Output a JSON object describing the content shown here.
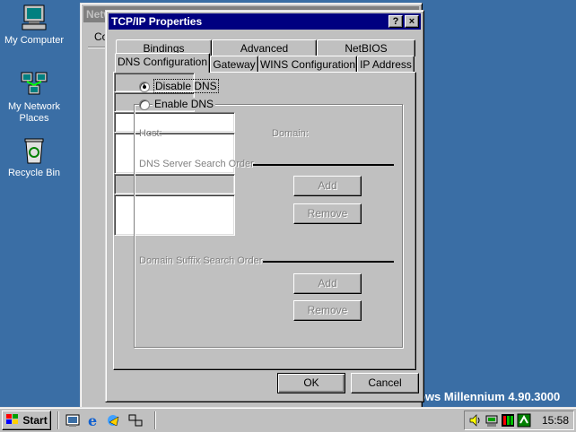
{
  "desktop": {
    "icons": [
      {
        "label": "My Computer",
        "icon": "my-computer-icon"
      },
      {
        "label": "My Network Places",
        "icon": "network-places-icon"
      },
      {
        "label": "Recycle Bin",
        "icon": "recycle-bin-icon"
      }
    ],
    "watermark": "ows Millennium 4.90.3000"
  },
  "background_window": {
    "title": "Network",
    "tab_label": "Co"
  },
  "dialog": {
    "title": "TCP/IP Properties",
    "help_button": "?",
    "close_button": "×",
    "tabs_back": [
      "Bindings",
      "Advanced",
      "NetBIOS"
    ],
    "tabs_front": [
      "DNS Configuration",
      "Gateway",
      "WINS Configuration",
      "IP Address"
    ],
    "active_tab": "DNS Configuration",
    "disable_dns": {
      "label": "Disable DNS",
      "selected": true
    },
    "enable_dns": {
      "label": "Enable DNS",
      "selected": false
    },
    "host_label": "Host:",
    "host_value": "",
    "domain_label": "Domain:",
    "domain_value": "",
    "dns_server_section": "DNS Server Search Order",
    "dns_server_dots": ".",
    "dns_add_button": "Add",
    "dns_remove_button": "Remove",
    "suffix_section": "Domain Suffix Search Order",
    "suffix_add_button": "Add",
    "suffix_remove_button": "Remove",
    "ok_button": "OK",
    "cancel_button": "Cancel"
  },
  "taskbar": {
    "start_label": "Start",
    "quick_launch": [
      "show-desktop-icon",
      "internet-explorer-icon",
      "outlook-express-icon",
      "network-icon"
    ],
    "tray_icons": [
      "volume-icon",
      "network-tray-icon",
      "meter-icon",
      "display-icon"
    ],
    "clock": "15:58"
  },
  "colors": {
    "desktop": "#3a6ea5",
    "title_active": "#000080",
    "face": "#c0c0c0"
  }
}
